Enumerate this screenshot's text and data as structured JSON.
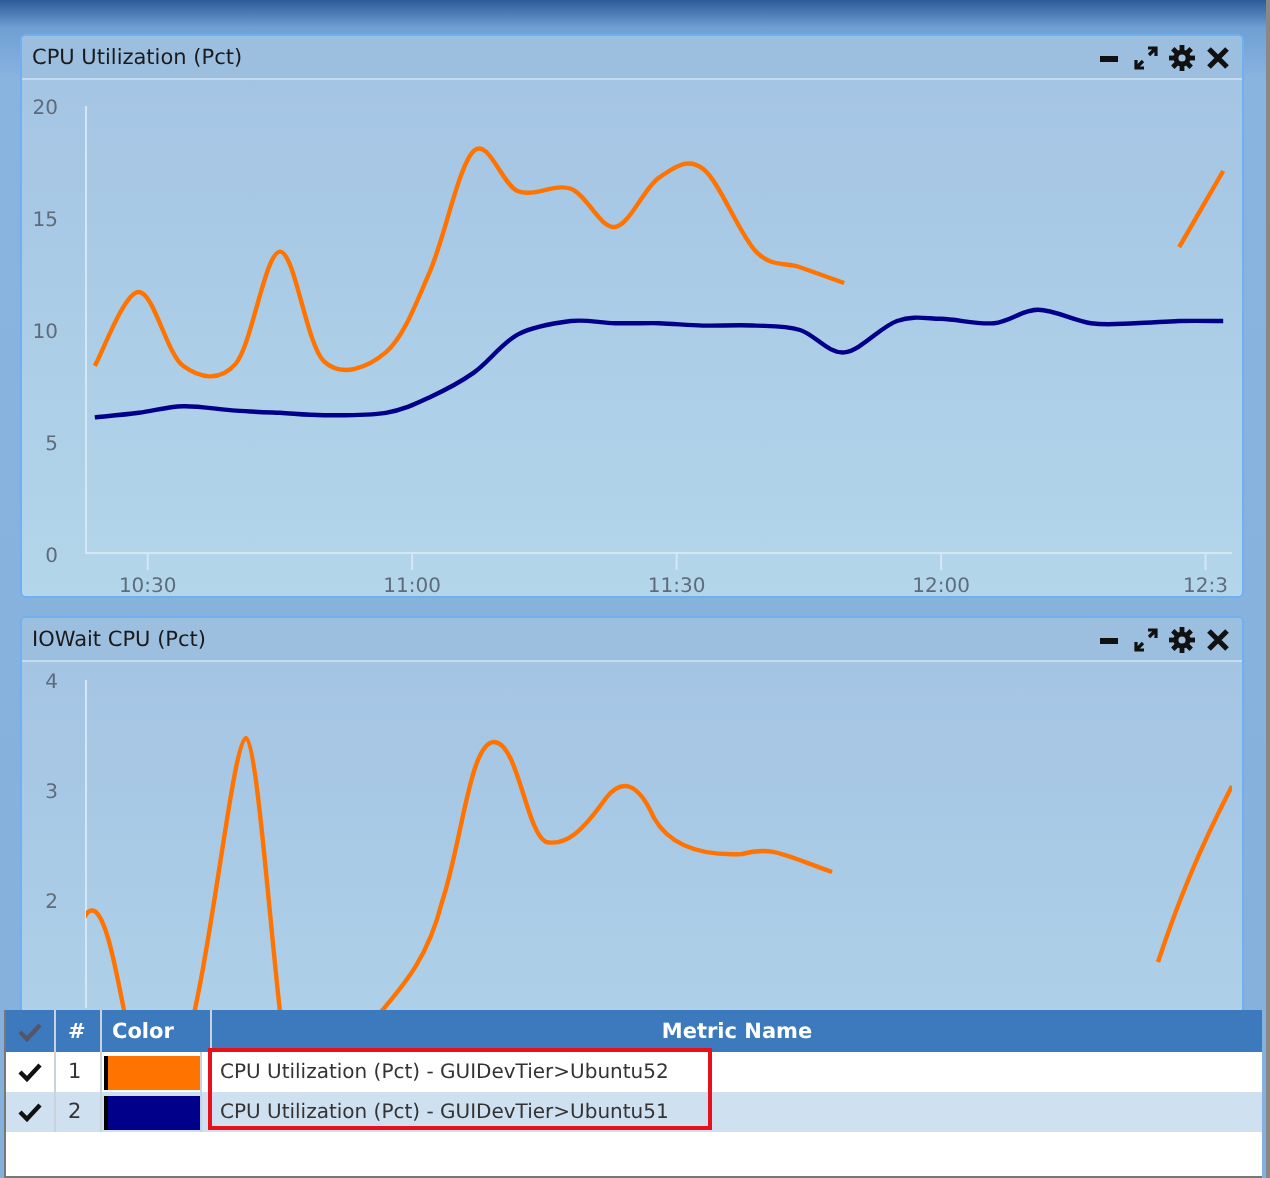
{
  "panels": [
    {
      "title": "CPU Utilization (Pct)",
      "chart_data": {
        "type": "line",
        "x": [
          624,
          629,
          634,
          640,
          645,
          650,
          657,
          662,
          667,
          672,
          678,
          683,
          688,
          693,
          699,
          704,
          709,
          715,
          720,
          726,
          731,
          737,
          742,
          747,
          752
        ],
        "xlim": [
          623,
          753
        ],
        "ylim": [
          0,
          20
        ],
        "yticks": [
          0,
          5,
          10,
          15,
          20
        ],
        "xticks": [
          {
            "value": 630,
            "label": "10:30"
          },
          {
            "value": 660,
            "label": "11:00"
          },
          {
            "value": 690,
            "label": "11:30"
          },
          {
            "value": 720,
            "label": "12:00"
          },
          {
            "value": 750,
            "label": "12:3"
          }
        ],
        "series": [
          {
            "name": "CPU Utilization (Pct) - GUIDevTier>Ubuntu52",
            "color": "#ff7300",
            "values": [
              8.4,
              11.7,
              8.4,
              8.5,
              13.5,
              8.6,
              9.0,
              12.6,
              18.0,
              16.2,
              16.3,
              14.6,
              16.8,
              17.2,
              13.5,
              12.8,
              12.1,
              null,
              null,
              null,
              null,
              null,
              null,
              13.7,
              17.1
            ]
          },
          {
            "name": "CPU Utilization (Pct) - GUIDevTier>Ubuntu51",
            "color": "#00008b",
            "values": [
              6.1,
              6.3,
              6.6,
              6.4,
              6.3,
              6.2,
              6.3,
              7.0,
              8.1,
              9.8,
              10.4,
              10.3,
              10.3,
              10.2,
              10.2,
              10.0,
              9.0,
              10.4,
              10.5,
              10.3,
              10.9,
              10.3,
              10.3,
              10.4,
              10.4
            ]
          }
        ]
      }
    },
    {
      "title": "IOWait CPU (Pct)",
      "axis_labels": [
        "4",
        "3",
        "2"
      ]
    }
  ],
  "legend": {
    "columns": [
      "#",
      "Color",
      "Metric Name"
    ],
    "rows": [
      {
        "checked": true,
        "number": "1",
        "highlighted": true,
        "selected": false
      },
      {
        "checked": true,
        "number": "2",
        "highlighted": true,
        "selected": true
      }
    ]
  }
}
